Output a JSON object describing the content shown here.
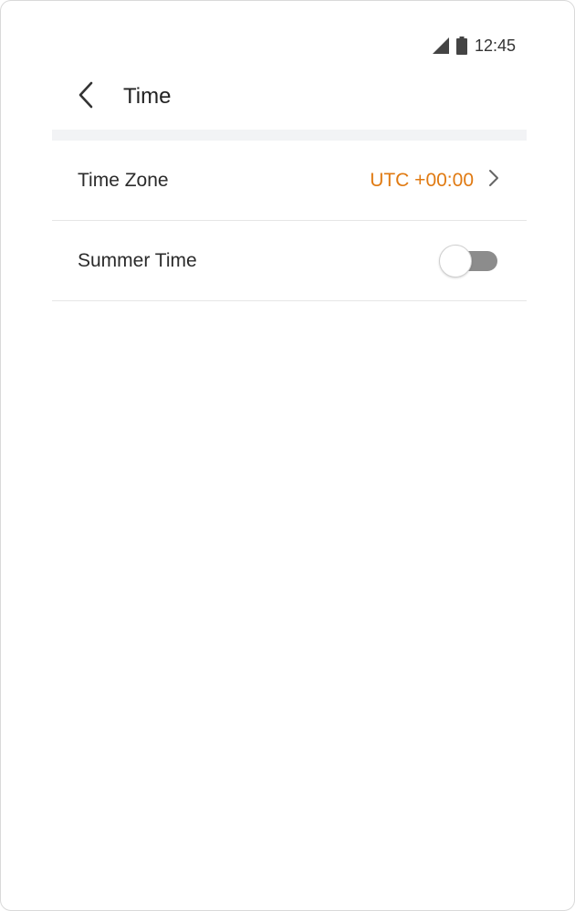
{
  "status_bar": {
    "time": "12:45"
  },
  "header": {
    "title": "Time"
  },
  "settings": {
    "time_zone": {
      "label": "Time Zone",
      "value": "UTC +00:00"
    },
    "summer_time": {
      "label": "Summer Time",
      "enabled": false
    }
  },
  "colors": {
    "accent": "#e07a12",
    "toggle_track_off": "#8c8c8c",
    "divider": "#e6e6e6",
    "section_gap": "#f2f3f5"
  },
  "icons": {
    "signal": "signal-icon",
    "battery": "battery-icon",
    "back": "chevron-left-icon",
    "chevron": "chevron-right-icon"
  }
}
